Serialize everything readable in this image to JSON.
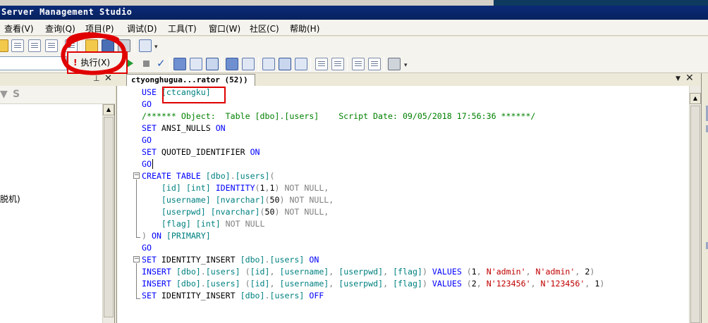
{
  "window": {
    "title": "Server Management Studio"
  },
  "menu": [
    "查看(V)",
    "查询(Q)",
    "项目(P)",
    "调试(D)",
    "工具(T)",
    "窗口(W)",
    "社区(C)",
    "帮助(H)"
  ],
  "toolbar": {
    "execute_label": "执行(X)",
    "execute_icon": "exclamation-icon"
  },
  "left_panel": {
    "node_label": "脱机)"
  },
  "editor": {
    "tab_title": "ctyonghugua...rator (52))",
    "lines": [
      [
        [
          "kw",
          "USE "
        ],
        [
          "tl",
          "[ctcangku]"
        ]
      ],
      [
        [
          "kw",
          "GO"
        ]
      ],
      [
        [
          "gn",
          "/****** Object:  Table [dbo].[users]    Script Date: 09/05/2018 17:56:36 ******/"
        ]
      ],
      [
        [
          "kw",
          "SET "
        ],
        [
          "nm",
          "ANSI_NULLS "
        ],
        [
          "kw",
          "ON"
        ]
      ],
      [
        [
          "kw",
          "GO"
        ]
      ],
      [
        [
          "kw",
          "SET "
        ],
        [
          "nm",
          "QUOTED_IDENTIFIER "
        ],
        [
          "kw",
          "ON"
        ]
      ],
      [
        [
          "kw",
          "GO"
        ]
      ],
      [
        [
          "kw",
          "CREATE TABLE "
        ],
        [
          "tl",
          "[dbo]"
        ],
        [
          "gr",
          "."
        ],
        [
          "tl",
          "[users]"
        ],
        [
          "gr",
          "("
        ]
      ],
      [
        [
          "nm",
          "    "
        ],
        [
          "tl",
          "[id] [int] "
        ],
        [
          "kw",
          "IDENTITY"
        ],
        [
          "gr",
          "("
        ],
        [
          "nm",
          "1"
        ],
        [
          "gr",
          ","
        ],
        [
          "nm",
          "1"
        ],
        [
          "gr",
          ") "
        ],
        [
          "gr",
          "NOT NULL"
        ],
        [
          "gr",
          ","
        ]
      ],
      [
        [
          "nm",
          "    "
        ],
        [
          "tl",
          "[username] [nvarchar]"
        ],
        [
          "gr",
          "("
        ],
        [
          "nm",
          "50"
        ],
        [
          "gr",
          ") "
        ],
        [
          "gr",
          "NOT NULL"
        ],
        [
          "gr",
          ","
        ]
      ],
      [
        [
          "nm",
          "    "
        ],
        [
          "tl",
          "[userpwd] [nvarchar]"
        ],
        [
          "gr",
          "("
        ],
        [
          "nm",
          "50"
        ],
        [
          "gr",
          ") "
        ],
        [
          "gr",
          "NOT NULL"
        ],
        [
          "gr",
          ","
        ]
      ],
      [
        [
          "nm",
          "    "
        ],
        [
          "tl",
          "[flag] [int] "
        ],
        [
          "gr",
          "NOT NULL"
        ]
      ],
      [
        [
          "gr",
          ") "
        ],
        [
          "kw",
          "ON "
        ],
        [
          "tl",
          "[PRIMARY]"
        ]
      ],
      [
        [
          "kw",
          "GO"
        ]
      ],
      [
        [
          "kw",
          "SET "
        ],
        [
          "nm",
          "IDENTITY_INSERT "
        ],
        [
          "tl",
          "[dbo]"
        ],
        [
          "gr",
          "."
        ],
        [
          "tl",
          "[users] "
        ],
        [
          "kw",
          "ON"
        ]
      ],
      [
        [
          "kw",
          "INSERT "
        ],
        [
          "tl",
          "[dbo]"
        ],
        [
          "gr",
          "."
        ],
        [
          "tl",
          "[users] "
        ],
        [
          "gr",
          "("
        ],
        [
          "tl",
          "[id]"
        ],
        [
          "gr",
          ", "
        ],
        [
          "tl",
          "[username]"
        ],
        [
          "gr",
          ", "
        ],
        [
          "tl",
          "[userpwd]"
        ],
        [
          "gr",
          ", "
        ],
        [
          "tl",
          "[flag]"
        ],
        [
          "gr",
          ") "
        ],
        [
          "kw",
          "VALUES "
        ],
        [
          "gr",
          "("
        ],
        [
          "nm",
          "1"
        ],
        [
          "gr",
          ", "
        ],
        [
          "rd",
          "N'admin'"
        ],
        [
          "gr",
          ", "
        ],
        [
          "rd",
          "N'admin'"
        ],
        [
          "gr",
          ", "
        ],
        [
          "nm",
          "2"
        ],
        [
          "gr",
          ")"
        ]
      ],
      [
        [
          "kw",
          "INSERT "
        ],
        [
          "tl",
          "[dbo]"
        ],
        [
          "gr",
          "."
        ],
        [
          "tl",
          "[users] "
        ],
        [
          "gr",
          "("
        ],
        [
          "tl",
          "[id]"
        ],
        [
          "gr",
          ", "
        ],
        [
          "tl",
          "[username]"
        ],
        [
          "gr",
          ", "
        ],
        [
          "tl",
          "[userpwd]"
        ],
        [
          "gr",
          ", "
        ],
        [
          "tl",
          "[flag]"
        ],
        [
          "gr",
          ") "
        ],
        [
          "kw",
          "VALUES "
        ],
        [
          "gr",
          "("
        ],
        [
          "nm",
          "2"
        ],
        [
          "gr",
          ", "
        ],
        [
          "rd",
          "N'123456'"
        ],
        [
          "gr",
          ", "
        ],
        [
          "rd",
          "N'123456'"
        ],
        [
          "gr",
          ", "
        ],
        [
          "nm",
          "1"
        ],
        [
          "gr",
          ")"
        ]
      ],
      [
        [
          "kw",
          "SET "
        ],
        [
          "nm",
          "IDENTITY_INSERT "
        ],
        [
          "tl",
          "[dbo]"
        ],
        [
          "gr",
          "."
        ],
        [
          "tl",
          "[users] "
        ],
        [
          "kw",
          "OFF"
        ]
      ]
    ]
  },
  "colors": {
    "title_bar": "#0a246a",
    "annotation": "#e00000",
    "keyword": "#0000ff",
    "comment": "#008000",
    "string": "#c00000"
  }
}
